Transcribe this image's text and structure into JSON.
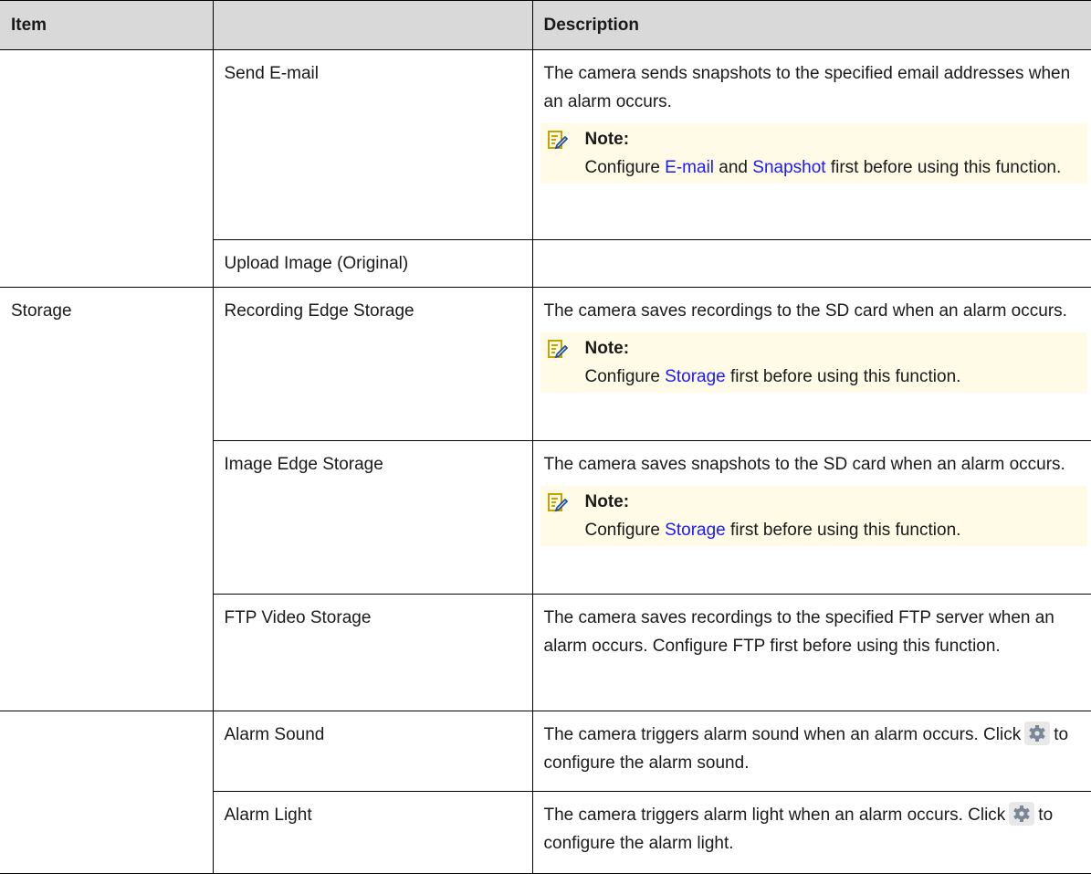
{
  "headers": {
    "item": "Item",
    "sub": "",
    "description": "Description"
  },
  "rows": {
    "email": {
      "item": "Send E-mail",
      "desc": "The camera sends snapshots to the specified email addresses when an alarm occurs.",
      "note_label": "Note:",
      "note_pre": "Configure",
      "note_link1": "E-mail",
      "note_mid": "and",
      "note_link2": "Snapshot",
      "note_post": "first before using this function."
    },
    "upload": {
      "item": "Upload Image (Original)",
      "desc": ""
    },
    "storage_group": "Storage",
    "rec": {
      "item": "Recording Edge Storage",
      "desc": "The camera saves recordings to the SD card when an alarm occurs.",
      "note_label": "Note:",
      "note_pre": "Configure",
      "note_link": "Storage",
      "note_post": "first before using this function."
    },
    "img": {
      "item": "Image Edge Storage",
      "desc": "The camera saves snapshots to the SD card when an alarm occurs.",
      "note_label": "Note:",
      "note_pre": "Configure",
      "note_link": "Storage",
      "note_post": "first before using this function."
    },
    "ftp": {
      "item": "FTP Video Storage",
      "desc": "The camera saves recordings to the specified FTP server when an alarm occurs. Configure FTP first before using this function."
    },
    "sound": {
      "item": "Alarm Sound",
      "desc_pre": "The camera triggers alarm sound when an alarm occurs. Click",
      "desc_post": "to configure the alarm sound."
    },
    "light": {
      "item": "Alarm Light",
      "desc_pre": "The camera triggers alarm light when an alarm occurs. Click",
      "desc_post": "to configure the alarm light."
    }
  },
  "icons": {
    "note": "note-pencil-icon",
    "gear": "gear-icon"
  },
  "colors": {
    "link": "#1a1aff",
    "note_bg": "#fffbe6",
    "header_bg": "#d9d9d9"
  }
}
